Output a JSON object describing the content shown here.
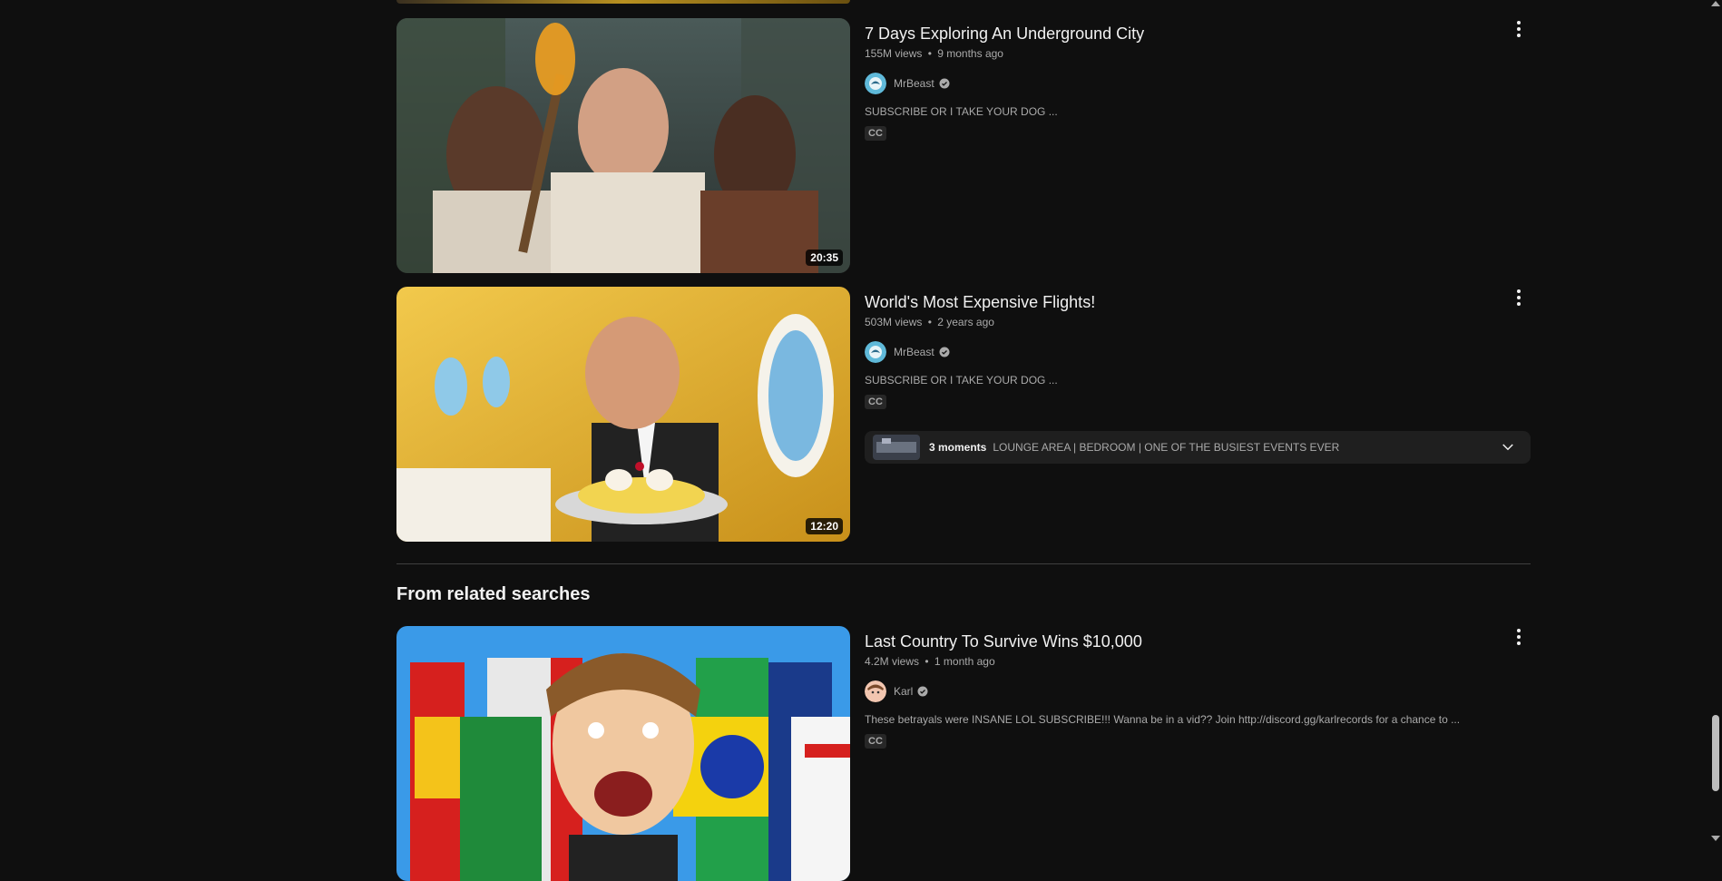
{
  "videos": [
    {
      "title": "7 Days Exploring An Underground City",
      "views": "155M views",
      "age": "9 months ago",
      "channel": "MrBeast",
      "description": "SUBSCRIBE OR I TAKE YOUR DOG ...",
      "cc_label": "CC",
      "duration": "20:35"
    },
    {
      "title": "World's Most Expensive Flights!",
      "views": "503M views",
      "age": "2 years ago",
      "channel": "MrBeast",
      "description": "SUBSCRIBE OR I TAKE YOUR DOG ...",
      "cc_label": "CC",
      "duration": "12:20",
      "moments": {
        "count_label": "3 moments",
        "labels": "LOUNGE AREA | BEDROOM | ONE OF THE BUSIEST EVENTS EVER"
      }
    }
  ],
  "related_section": {
    "heading": "From related searches",
    "videos": [
      {
        "title": "Last Country To Survive Wins $10,000",
        "views": "4.2M views",
        "age": "1 month ago",
        "channel": "Karl",
        "description": "These betrayals were INSANE LOL SUBSCRIBE!!! Wanna be in a vid?? Join http://discord.gg/karlrecords for a chance to ...",
        "cc_label": "CC"
      }
    ]
  },
  "meta_separator": "•",
  "icons": {
    "more": "more-vert-icon",
    "verified": "verified-check-icon",
    "expand": "chevron-down-icon"
  },
  "colors": {
    "background": "#0f0f0f",
    "primary_text": "#f1f1f1",
    "secondary_text": "#aaaaaa"
  }
}
